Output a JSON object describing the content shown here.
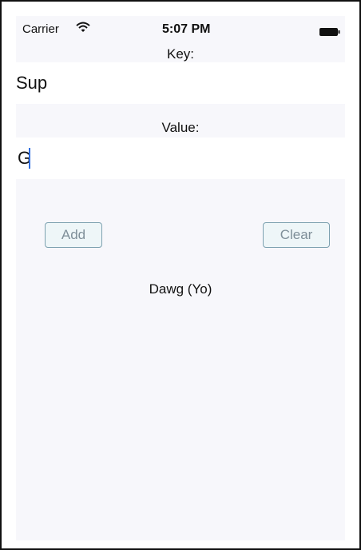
{
  "status_bar": {
    "carrier": "Carrier",
    "time": "5:07 PM",
    "wifi_icon": "wifi-icon",
    "battery_icon": "battery-icon"
  },
  "form": {
    "key_label": "Key:",
    "key_value": "Sup",
    "value_label": "Value:",
    "value_value": "G"
  },
  "actions": {
    "add_label": "Add",
    "clear_label": "Clear"
  },
  "result": {
    "text": "Dawg (Yo)"
  },
  "colors": {
    "panel_background": "#f7f7fb",
    "button_border": "#7da1b0",
    "button_text": "#7f8f99",
    "caret": "#2f6ee0"
  }
}
